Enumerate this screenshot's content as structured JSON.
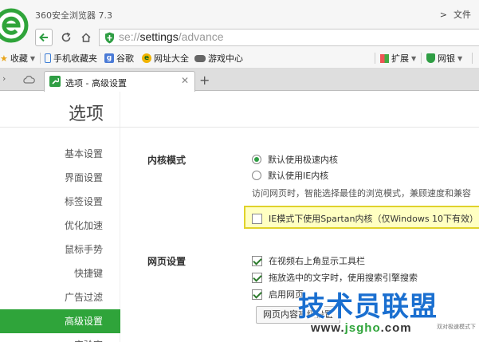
{
  "window": {
    "app_title": "360安全浏览器 7.3",
    "menu_arrow": ">",
    "file_menu": "文件"
  },
  "address": {
    "prefix": "se://",
    "bold": "settings",
    "suffix": "/advance"
  },
  "favorites": [
    {
      "icon": "star-icon",
      "label": "收藏"
    },
    {
      "icon": "phone-icon",
      "label": "手机收藏夹"
    },
    {
      "icon": "google-icon",
      "label": "谷歌"
    },
    {
      "icon": "web-directory-icon",
      "label": "网址大全"
    },
    {
      "icon": "gamepad-icon",
      "label": "游戏中心"
    }
  ],
  "favbar_right": {
    "extensions": "扩展",
    "netbank": "网银"
  },
  "tab": {
    "title": "选项 - 高级设置",
    "close": "✕",
    "new_tab": "+"
  },
  "page": {
    "title": "选项"
  },
  "sidebar": {
    "items": [
      {
        "label": "基本设置",
        "active": false
      },
      {
        "label": "界面设置",
        "active": false
      },
      {
        "label": "标签设置",
        "active": false
      },
      {
        "label": "优化加速",
        "active": false
      },
      {
        "label": "鼠标手势",
        "active": false
      },
      {
        "label": "快捷键",
        "active": false
      },
      {
        "label": "广告过滤",
        "active": false
      },
      {
        "label": "高级设置",
        "active": true
      },
      {
        "label": "实验室",
        "active": false
      }
    ]
  },
  "kernel": {
    "label": "内核模式",
    "option_fast": "默认使用极速内核",
    "option_ie": "默认使用IE内核",
    "hint": "访问网页时，智能选择最佳的浏览模式，兼顾速度和兼容",
    "spartan": "IE模式下使用Spartan内核（仅Windows 10下有效）"
  },
  "webpage": {
    "label": "网页设置",
    "opt_toolbar": "在视频右上角显示工具栏",
    "opt_drag_search": "拖放选中的文字时，使用搜索引擎搜索",
    "opt_third": "启用网页",
    "button": "网页内容高级设置"
  },
  "watermark": {
    "main": "技术员联盟",
    "url_prefix": "www.",
    "url_brand": "jsgho",
    "url_suffix": ".com",
    "small": "双对极速模式下"
  },
  "colors": {
    "accent_green": "#2fa43a",
    "highlight_bg": "#ffffc2",
    "highlight_border": "#e0d22a",
    "watermark_blue": "#1a6fd0"
  }
}
